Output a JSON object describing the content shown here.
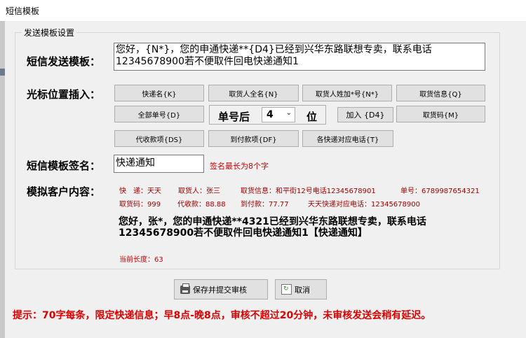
{
  "window": {
    "title": "短信模板"
  },
  "group": {
    "label": "发送模板设置"
  },
  "template": {
    "label": "短信发送模板：",
    "text": "您好，{N*}，您的申通快递**{D4}已经到兴华东路联想专卖，联系电话12345678900若不便取件回电快递通知1"
  },
  "insert": {
    "label": "光标位置插入：",
    "buttons": [
      "快递名{K}",
      "取货人全名{N}",
      "取货人姓加*号{N*}",
      "取货信息{Q}",
      "全部单号{D}",
      "取货码{M}",
      "代收款项{DS}",
      "到付款项{DF}",
      "各快递对应电话{T}"
    ],
    "digit_prefix": "单号后",
    "digit_value": "4",
    "digit_suffix": "位",
    "digit_button": "加入 {D4}"
  },
  "signature": {
    "label": "短信模板签名：",
    "value": "快递通知",
    "hint": "签名最长为8个字"
  },
  "preview": {
    "label": "模拟客户内容：",
    "line1": [
      "快　递：天天",
      "取货人：张三",
      "取货信息：和平街12号电话12345678901",
      "单号：6789987654321"
    ],
    "line2": [
      "取货码：999",
      "代收款：88.88",
      "到付款：77.77",
      "天天快递对应电话：12345678900"
    ],
    "message": "您好，张*，您的申通快递**4321已经到兴华东路联想专卖，联系电话12345678900若不便取件回电快递通知1【快递通知】",
    "length_label": "当前长度：63"
  },
  "footer": {
    "save_label": "保存并提交审核",
    "cancel_label": "取消",
    "tip": "提示：70字每条，限定快递信息；早8点-晚8点，审核不超过20分钟，未审核发送会稍有延迟。"
  },
  "colors": {
    "hint_red": "#cc0000",
    "tip_red": "#dd0000",
    "preview_red": "#a00000"
  }
}
